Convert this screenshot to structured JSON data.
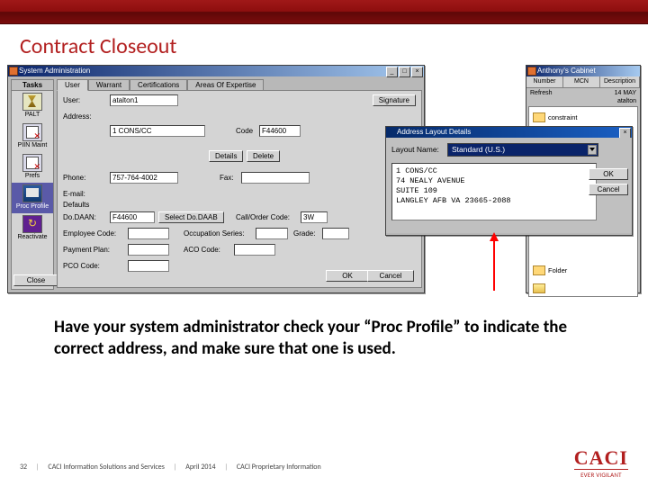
{
  "slide": {
    "title": "Contract Closeout",
    "instruction": "Have your system administrator check your “Proc Profile” to indicate the correct address, and make sure that one is used."
  },
  "footer": {
    "page": "32",
    "org": "CACI Information Solutions and Services",
    "date": "April 2014",
    "marking": "CACI Proprietary Information",
    "logo_text": "CACI",
    "logo_tag": "EVER VIGILANT"
  },
  "sysadmin": {
    "title": "System Administration",
    "sidebar": {
      "header": "Tasks",
      "items": [
        "PALT",
        "PIIN Maint",
        "Prefs",
        "Proc Profile",
        "Reactivate"
      ],
      "close": "Close"
    },
    "tabs": [
      "User",
      "Warrant",
      "Certifications",
      "Areas Of Expertise"
    ],
    "fields": {
      "user_label": "User:",
      "user_value": "atalton1",
      "address_label": "Address:",
      "address_value": "1 CONS/CC",
      "code_label": "Code",
      "code_value": "F44600",
      "phone_label": "Phone:",
      "phone_value": "757-764-4002",
      "fax_label": "Fax:",
      "email_label": "E-mail:",
      "defaults_label": "Defaults",
      "dodaan_label": "Do.DAAN:",
      "dodaan_value": "F44600",
      "select_dodaab": "Select Do.DAAB",
      "callorder_label": "Call/Order Code:",
      "callorder_value": "3W",
      "empcode_label": "Employee Code:",
      "occseries_label": "Occupation Series:",
      "grade_label": "Grade:",
      "payplan_label": "Payment Plan:",
      "acocode_label": "ACO Code:",
      "pcocode_label": "PCO Code:",
      "details_btn": "Details",
      "delete_btn": "Delete",
      "signature_btn": "Signature",
      "ok": "OK",
      "cancel": "Cancel"
    }
  },
  "cabinet": {
    "title": "Anthony's Cabinet",
    "refresh": "Refresh",
    "tabs": [
      "Number",
      "MCN",
      "Description"
    ],
    "date": "14 MAY",
    "user": "atalton",
    "folder1": "constraint",
    "folder2": "Folder"
  },
  "popup": {
    "title": "Address Layout Details",
    "layout_label": "Layout Name:",
    "layout_value": "Standard (U.S.)",
    "address": "1 CONS/CC\n74 NEALY AVENUE\nSUITE 109\nLANGLEY AFB VA 23665-2088",
    "ok": "OK",
    "cancel": "Cancel"
  }
}
